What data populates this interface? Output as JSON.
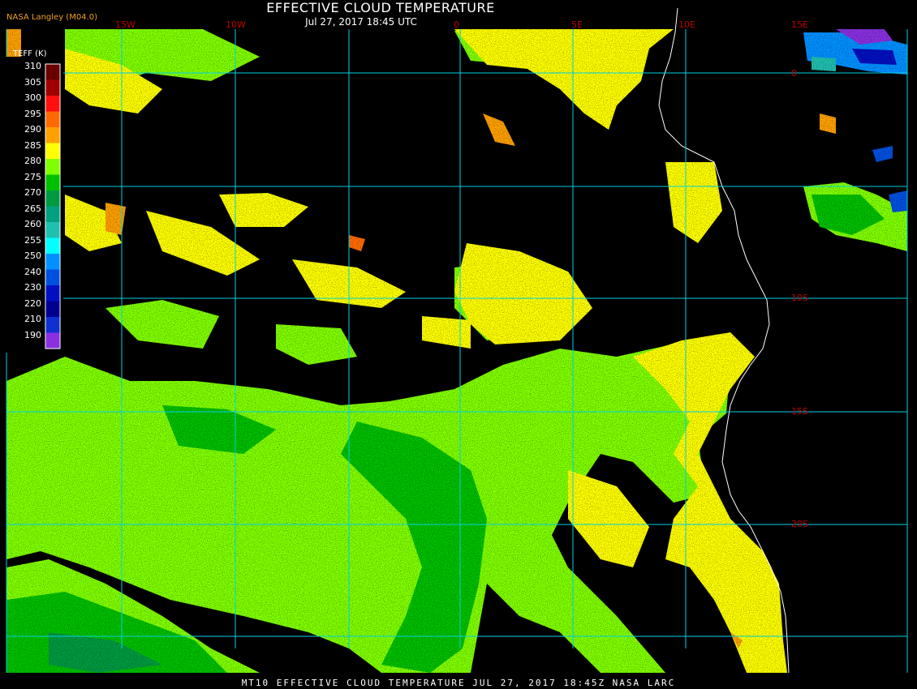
{
  "header": {
    "title": "EFFECTIVE CLOUD TEMPERATURE",
    "subtitle": "Jul 27, 2017 18:45 UTC",
    "credit": "NASA Langley (M04.0)"
  },
  "legend": {
    "title": "TEFF (K)",
    "levels": [
      {
        "label": "310",
        "color": "#6a0000"
      },
      {
        "label": "305",
        "color": "#a00000"
      },
      {
        "label": "300",
        "color": "#ff1010"
      },
      {
        "label": "295",
        "color": "#ff6a00"
      },
      {
        "label": "290",
        "color": "#ffa000"
      },
      {
        "label": "285",
        "color": "#ffff00"
      },
      {
        "label": "280",
        "color": "#80ff00"
      },
      {
        "label": "275",
        "color": "#00c000"
      },
      {
        "label": "270",
        "color": "#009a40"
      },
      {
        "label": "265",
        "color": "#00a080"
      },
      {
        "label": "260",
        "color": "#20c0b0"
      },
      {
        "label": "255",
        "color": "#00ffff"
      },
      {
        "label": "250",
        "color": "#0090ff"
      },
      {
        "label": "240",
        "color": "#0050e0"
      },
      {
        "label": "230",
        "color": "#0010c0"
      },
      {
        "label": "220",
        "color": "#000090"
      },
      {
        "label": "210",
        "color": "#1030d0"
      },
      {
        "label": "190",
        "color": "#8a30e0"
      }
    ]
  },
  "grid": {
    "longitudes": [
      "15W",
      "10W",
      "0",
      "5E",
      "10E",
      "15E"
    ],
    "latitudes": [
      "0",
      "10S",
      "15S",
      "20S"
    ]
  },
  "footer": "MT10  EFFECTIVE CLOUD TEMPERATURE  JUL 27, 2017 18:45Z  NASA LARC",
  "colors": {
    "background": "#000000",
    "grid_lines": "#00d0e0",
    "grid_labels": "#c00000",
    "coastline": "#ffffff"
  }
}
